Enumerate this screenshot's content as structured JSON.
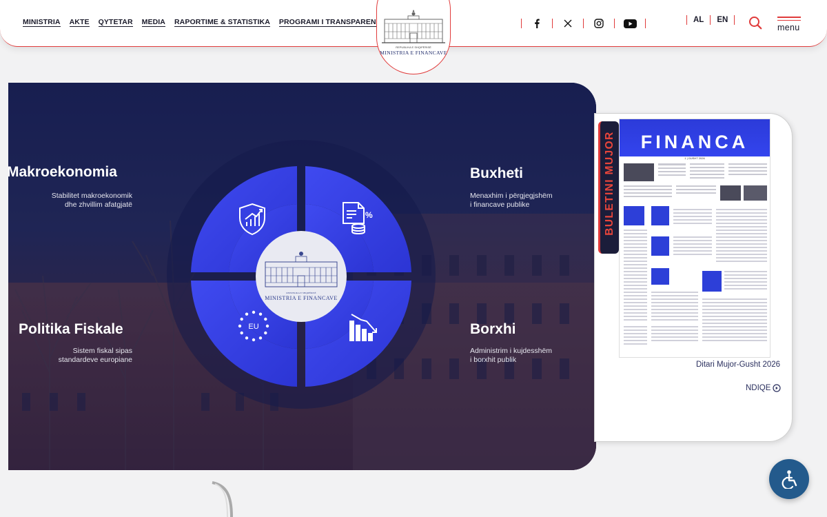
{
  "header": {
    "nav": [
      {
        "label": "MINISTRIA"
      },
      {
        "label": "AKTE"
      },
      {
        "label": "QYTETAR"
      },
      {
        "label": "MEDIA"
      },
      {
        "label": "RAPORTIME & STATISTIKA"
      },
      {
        "label": "PROGRAMI I TRANSPARENCËS"
      }
    ],
    "logo": {
      "top_text": "REPUBLIKA E SHQIPËRISË",
      "name": "MINISTRIA E FINANCAVE"
    },
    "social": [
      "facebook-icon",
      "x-twitter-icon",
      "instagram-icon",
      "youtube-icon"
    ],
    "languages": [
      {
        "label": "AL"
      },
      {
        "label": "EN"
      }
    ],
    "menu_label": "menu"
  },
  "hero": {
    "sections": [
      {
        "title": "Makroekonomia",
        "desc_1": "Stabilitet makroekonomik",
        "desc_2": "dhe zhvillim afatgjatë",
        "icon": "shield-growth-icon"
      },
      {
        "title": "Buxheti",
        "desc_1": "Menaxhim i përgjegjshëm",
        "desc_2": "i financave publike",
        "icon": "budget-document-coins-icon"
      },
      {
        "title": "Politika Fiskale",
        "desc_1": "Sistem fiskal sipas",
        "desc_2": "standardeve europiane",
        "icon": "eu-stars-icon"
      },
      {
        "title": "Borxhi",
        "desc_1": "Administrim i kujdesshëm",
        "desc_2": "i borxhit publik",
        "icon": "declining-chart-icon"
      }
    ],
    "center_logo": {
      "top_text": "REPUBLIKA E SHQIPËRISË",
      "name": "MINISTRIA E FINANCAVE"
    },
    "eu_label": "EU"
  },
  "bulletin": {
    "tab_label": "BULETINI MUJOR",
    "cover_title": "FINANCA",
    "cover_date": "1 | GUSHT 2026",
    "caption": "Ditari Mujor-Gusht 2026",
    "link_label": "NDIQE"
  },
  "colors": {
    "accent_red": "#e03a3a",
    "navy": "#1a1a2a",
    "quad_blue": "#3340e0",
    "cover_blue": "#3344ee",
    "access_blue": "#235a8c"
  }
}
